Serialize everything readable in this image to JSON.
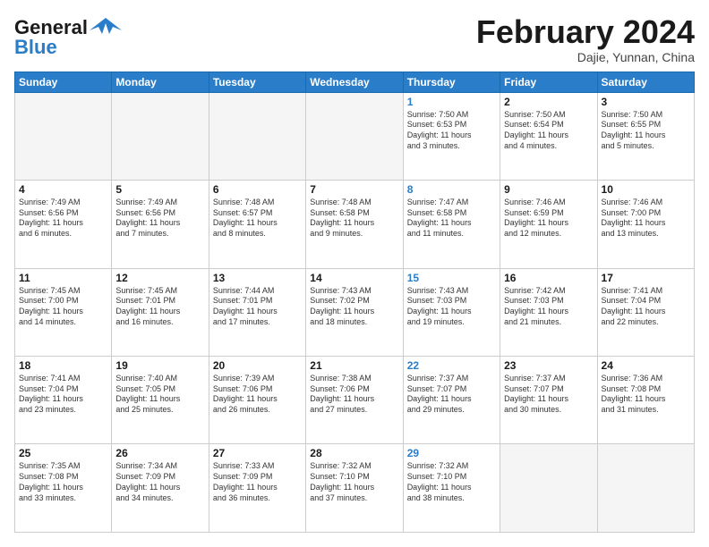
{
  "logo": {
    "part1": "General",
    "part2": "Blue"
  },
  "title": "February 2024",
  "subtitle": "Dajie, Yunnan, China",
  "days_of_week": [
    "Sunday",
    "Monday",
    "Tuesday",
    "Wednesday",
    "Thursday",
    "Friday",
    "Saturday"
  ],
  "weeks": [
    [
      {
        "day": "",
        "text": ""
      },
      {
        "day": "",
        "text": ""
      },
      {
        "day": "",
        "text": ""
      },
      {
        "day": "",
        "text": ""
      },
      {
        "day": "1",
        "text": "Sunrise: 7:50 AM\nSunset: 6:53 PM\nDaylight: 11 hours\nand 3 minutes.",
        "is_thursday": true
      },
      {
        "day": "2",
        "text": "Sunrise: 7:50 AM\nSunset: 6:54 PM\nDaylight: 11 hours\nand 4 minutes."
      },
      {
        "day": "3",
        "text": "Sunrise: 7:50 AM\nSunset: 6:55 PM\nDaylight: 11 hours\nand 5 minutes."
      }
    ],
    [
      {
        "day": "4",
        "text": "Sunrise: 7:49 AM\nSunset: 6:56 PM\nDaylight: 11 hours\nand 6 minutes."
      },
      {
        "day": "5",
        "text": "Sunrise: 7:49 AM\nSunset: 6:56 PM\nDaylight: 11 hours\nand 7 minutes."
      },
      {
        "day": "6",
        "text": "Sunrise: 7:48 AM\nSunset: 6:57 PM\nDaylight: 11 hours\nand 8 minutes."
      },
      {
        "day": "7",
        "text": "Sunrise: 7:48 AM\nSunset: 6:58 PM\nDaylight: 11 hours\nand 9 minutes."
      },
      {
        "day": "8",
        "text": "Sunrise: 7:47 AM\nSunset: 6:58 PM\nDaylight: 11 hours\nand 11 minutes.",
        "is_thursday": true
      },
      {
        "day": "9",
        "text": "Sunrise: 7:46 AM\nSunset: 6:59 PM\nDaylight: 11 hours\nand 12 minutes."
      },
      {
        "day": "10",
        "text": "Sunrise: 7:46 AM\nSunset: 7:00 PM\nDaylight: 11 hours\nand 13 minutes."
      }
    ],
    [
      {
        "day": "11",
        "text": "Sunrise: 7:45 AM\nSunset: 7:00 PM\nDaylight: 11 hours\nand 14 minutes."
      },
      {
        "day": "12",
        "text": "Sunrise: 7:45 AM\nSunset: 7:01 PM\nDaylight: 11 hours\nand 16 minutes."
      },
      {
        "day": "13",
        "text": "Sunrise: 7:44 AM\nSunset: 7:01 PM\nDaylight: 11 hours\nand 17 minutes."
      },
      {
        "day": "14",
        "text": "Sunrise: 7:43 AM\nSunset: 7:02 PM\nDaylight: 11 hours\nand 18 minutes."
      },
      {
        "day": "15",
        "text": "Sunrise: 7:43 AM\nSunset: 7:03 PM\nDaylight: 11 hours\nand 19 minutes.",
        "is_thursday": true
      },
      {
        "day": "16",
        "text": "Sunrise: 7:42 AM\nSunset: 7:03 PM\nDaylight: 11 hours\nand 21 minutes."
      },
      {
        "day": "17",
        "text": "Sunrise: 7:41 AM\nSunset: 7:04 PM\nDaylight: 11 hours\nand 22 minutes."
      }
    ],
    [
      {
        "day": "18",
        "text": "Sunrise: 7:41 AM\nSunset: 7:04 PM\nDaylight: 11 hours\nand 23 minutes."
      },
      {
        "day": "19",
        "text": "Sunrise: 7:40 AM\nSunset: 7:05 PM\nDaylight: 11 hours\nand 25 minutes."
      },
      {
        "day": "20",
        "text": "Sunrise: 7:39 AM\nSunset: 7:06 PM\nDaylight: 11 hours\nand 26 minutes."
      },
      {
        "day": "21",
        "text": "Sunrise: 7:38 AM\nSunset: 7:06 PM\nDaylight: 11 hours\nand 27 minutes."
      },
      {
        "day": "22",
        "text": "Sunrise: 7:37 AM\nSunset: 7:07 PM\nDaylight: 11 hours\nand 29 minutes.",
        "is_thursday": true
      },
      {
        "day": "23",
        "text": "Sunrise: 7:37 AM\nSunset: 7:07 PM\nDaylight: 11 hours\nand 30 minutes."
      },
      {
        "day": "24",
        "text": "Sunrise: 7:36 AM\nSunset: 7:08 PM\nDaylight: 11 hours\nand 31 minutes."
      }
    ],
    [
      {
        "day": "25",
        "text": "Sunrise: 7:35 AM\nSunset: 7:08 PM\nDaylight: 11 hours\nand 33 minutes."
      },
      {
        "day": "26",
        "text": "Sunrise: 7:34 AM\nSunset: 7:09 PM\nDaylight: 11 hours\nand 34 minutes."
      },
      {
        "day": "27",
        "text": "Sunrise: 7:33 AM\nSunset: 7:09 PM\nDaylight: 11 hours\nand 36 minutes."
      },
      {
        "day": "28",
        "text": "Sunrise: 7:32 AM\nSunset: 7:10 PM\nDaylight: 11 hours\nand 37 minutes."
      },
      {
        "day": "29",
        "text": "Sunrise: 7:32 AM\nSunset: 7:10 PM\nDaylight: 11 hours\nand 38 minutes.",
        "is_thursday": true
      },
      {
        "day": "",
        "text": ""
      },
      {
        "day": "",
        "text": ""
      }
    ]
  ]
}
